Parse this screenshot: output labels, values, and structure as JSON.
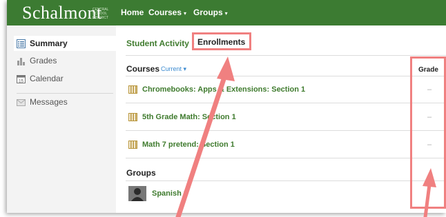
{
  "app": {
    "logo_text": "Schalmont",
    "logo_subtext": "CENTRAL SCHOOL DISTRICT"
  },
  "nav": {
    "home": "Home",
    "courses": "Courses",
    "groups": "Groups",
    "caret": "▾"
  },
  "sidebar": {
    "items": [
      {
        "label": "Summary",
        "icon": "list-icon",
        "active": true
      },
      {
        "label": "Grades",
        "icon": "bar-chart-icon",
        "active": false
      },
      {
        "label": "Calendar",
        "icon": "calendar-icon",
        "active": false
      },
      {
        "label": "Messages",
        "icon": "message-icon",
        "active": false
      }
    ],
    "calendar_day": "15"
  },
  "breadcrumb": {
    "parent": "Student Activity",
    "separator": "›",
    "current": "Enrollments"
  },
  "courses": {
    "title": "Courses",
    "filter": "Current ▾",
    "grade_header": "Grade",
    "rows": [
      {
        "name": "Chromebooks: Apps & Extensions: Section 1",
        "grade": "–"
      },
      {
        "name": "5th Grade Math: Section 1",
        "grade": "–"
      },
      {
        "name": "Math 7 pretend: Section 1",
        "grade": "–"
      }
    ]
  },
  "groups": {
    "title": "Groups",
    "rows": [
      {
        "name": "Spanish 3"
      }
    ]
  },
  "colors": {
    "topbar": "#3c7b32",
    "link_green": "#3f7b2e",
    "annotation": "#f08080",
    "filter_blue": "#3a8ad0"
  }
}
